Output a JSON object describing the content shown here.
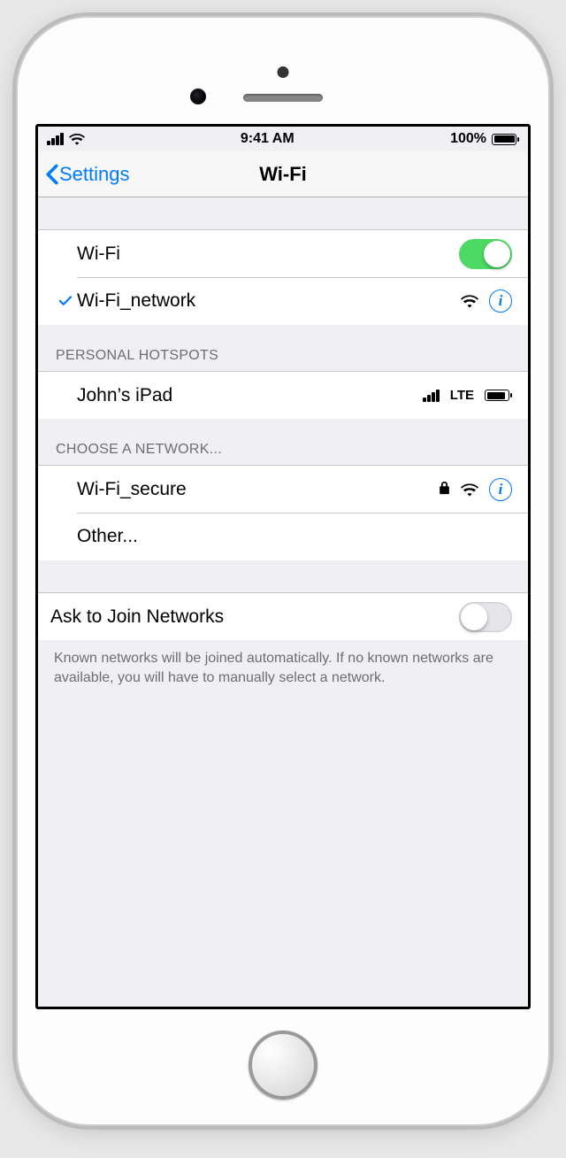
{
  "status_bar": {
    "time": "9:41 AM",
    "battery_pct": "100%"
  },
  "nav": {
    "back_label": "Settings",
    "title": "Wi-Fi"
  },
  "wifi": {
    "toggle_label": "Wi-Fi",
    "toggle_on": true,
    "connected_network": "Wi-Fi_network"
  },
  "sections": {
    "hotspots_header": "PERSONAL HOTSPOTS",
    "hotspots": [
      {
        "name": "John’s iPad",
        "carrier": "LTE"
      }
    ],
    "choose_header": "CHOOSE A NETWORK...",
    "networks": [
      {
        "name": "Wi-Fi_secure",
        "locked": true
      }
    ],
    "other_label": "Other..."
  },
  "ask_join": {
    "label": "Ask to Join Networks",
    "on": false,
    "footer": "Known networks will be joined automatically. If no known networks are available, you will have to manually select a network."
  }
}
